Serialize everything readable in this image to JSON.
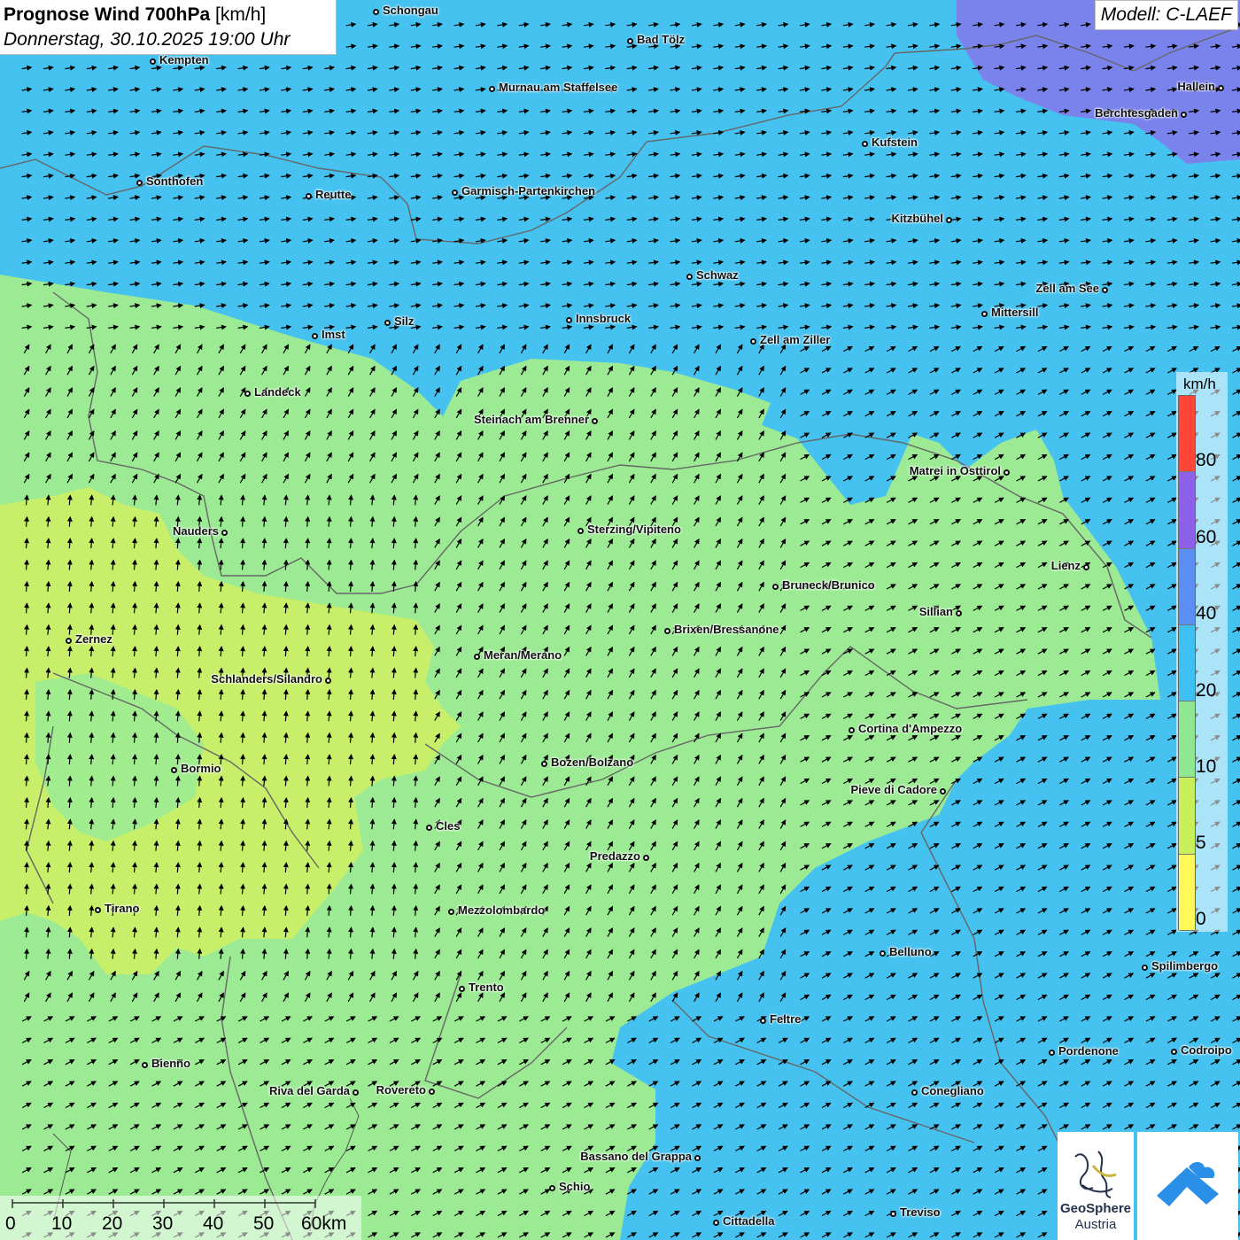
{
  "header": {
    "title": "Prognose Wind 700hPa",
    "unit": "[km/h]",
    "datetime": "Donnerstag, 30.10.2025 19:00 Uhr",
    "model": "Modell: C-LAEF"
  },
  "legend": {
    "unit": "km/h",
    "ticks": [
      "80",
      "60",
      "40",
      "20",
      "10",
      "5",
      "0"
    ],
    "colors": [
      "#ff4538",
      "#8c60e8",
      "#5a8ef2",
      "#3ec1f2",
      "#8fe890",
      "#c7f05a",
      "#fff85a"
    ]
  },
  "scale_bar": {
    "labels": [
      "0",
      "10",
      "20",
      "30",
      "40",
      "50",
      "60km"
    ]
  },
  "logos": {
    "geosphere_line1": "GeoSphere",
    "geosphere_line2": "Austria"
  },
  "colors": {
    "strong_wind": "#7a82ec",
    "medium_wind": "#46c2f0",
    "light_wind": "#9ceb94",
    "very_light_wind": "#c8ef6a",
    "border": "#666666"
  },
  "cities": [
    {
      "name": "Schongau",
      "label": "Schongau"
    },
    {
      "name": "Bad Tölz",
      "label": "Bad Tölz"
    },
    {
      "name": "Kempten",
      "label": "Kempten"
    },
    {
      "name": "Murnau",
      "label": "Murnau am Staffelsee"
    },
    {
      "name": "Hallein",
      "label": "Hallein"
    },
    {
      "name": "Berchtesgaden",
      "label": "Berchtesgaden"
    },
    {
      "name": "Kufstein",
      "label": "Kufstein"
    },
    {
      "name": "Sonthofen",
      "label": "Sonthofen"
    },
    {
      "name": "Reutte",
      "label": "Reutte"
    },
    {
      "name": "Garmisch",
      "label": "Garmisch-Partenkirchen"
    },
    {
      "name": "Kitzbühel",
      "label": "Kitzbühel"
    },
    {
      "name": "Schwaz",
      "label": "Schwaz"
    },
    {
      "name": "Zell am See",
      "label": "Zell am See"
    },
    {
      "name": "Mittersill",
      "label": "Mittersill"
    },
    {
      "name": "Innsbruck",
      "label": "Innsbruck"
    },
    {
      "name": "Silz",
      "label": "Silz"
    },
    {
      "name": "Imst",
      "label": "Imst"
    },
    {
      "name": "Zell am Ziller",
      "label": "Zell am Ziller"
    },
    {
      "name": "Landeck",
      "label": "Landeck"
    },
    {
      "name": "Steinach",
      "label": "Steinach am Brenner"
    },
    {
      "name": "Matrei",
      "label": "Matrei in Osttirol"
    },
    {
      "name": "Nauders",
      "label": "Nauders"
    },
    {
      "name": "Sterzing",
      "label": "Sterzing/Vipiteno"
    },
    {
      "name": "Lienz",
      "label": "Lienz"
    },
    {
      "name": "Bruneck",
      "label": "Bruneck/Brunico"
    },
    {
      "name": "Sillian",
      "label": "Sillian"
    },
    {
      "name": "Brixen",
      "label": "Brixen/Bressanone"
    },
    {
      "name": "Zernez",
      "label": "Zernez"
    },
    {
      "name": "Meran",
      "label": "Meran/Merano"
    },
    {
      "name": "Schlanders",
      "label": "Schlanders/Silandro"
    },
    {
      "name": "Cortina",
      "label": "Cortina d'Ampezzo"
    },
    {
      "name": "Bozen",
      "label": "Bozen/Bolzano"
    },
    {
      "name": "Bormio",
      "label": "Bormio"
    },
    {
      "name": "Pieve di Cadore",
      "label": "Pieve di Cadore"
    },
    {
      "name": "Cles",
      "label": "Cles"
    },
    {
      "name": "Predazzo",
      "label": "Predazzo"
    },
    {
      "name": "Tirano",
      "label": "Tirano"
    },
    {
      "name": "Mezzolombardo",
      "label": "Mezzolombardo"
    },
    {
      "name": "Belluno",
      "label": "Belluno"
    },
    {
      "name": "Spilimbergo",
      "label": "Spilimbergo"
    },
    {
      "name": "Trento",
      "label": "Trento"
    },
    {
      "name": "Feltre",
      "label": "Feltre"
    },
    {
      "name": "Pordenone",
      "label": "Pordenone"
    },
    {
      "name": "Codroipo",
      "label": "Codroipo"
    },
    {
      "name": "Bienno",
      "label": "Bienno"
    },
    {
      "name": "Riva del Garda",
      "label": "Riva del Garda"
    },
    {
      "name": "Rovereto",
      "label": "Rovereto"
    },
    {
      "name": "Conegliano",
      "label": "Conegliano"
    },
    {
      "name": "Bassano",
      "label": "Bassano del Grappa"
    },
    {
      "name": "Schio",
      "label": "Schio"
    },
    {
      "name": "Treviso",
      "label": "Treviso"
    },
    {
      "name": "Cittadella",
      "label": "Cittadella"
    }
  ]
}
